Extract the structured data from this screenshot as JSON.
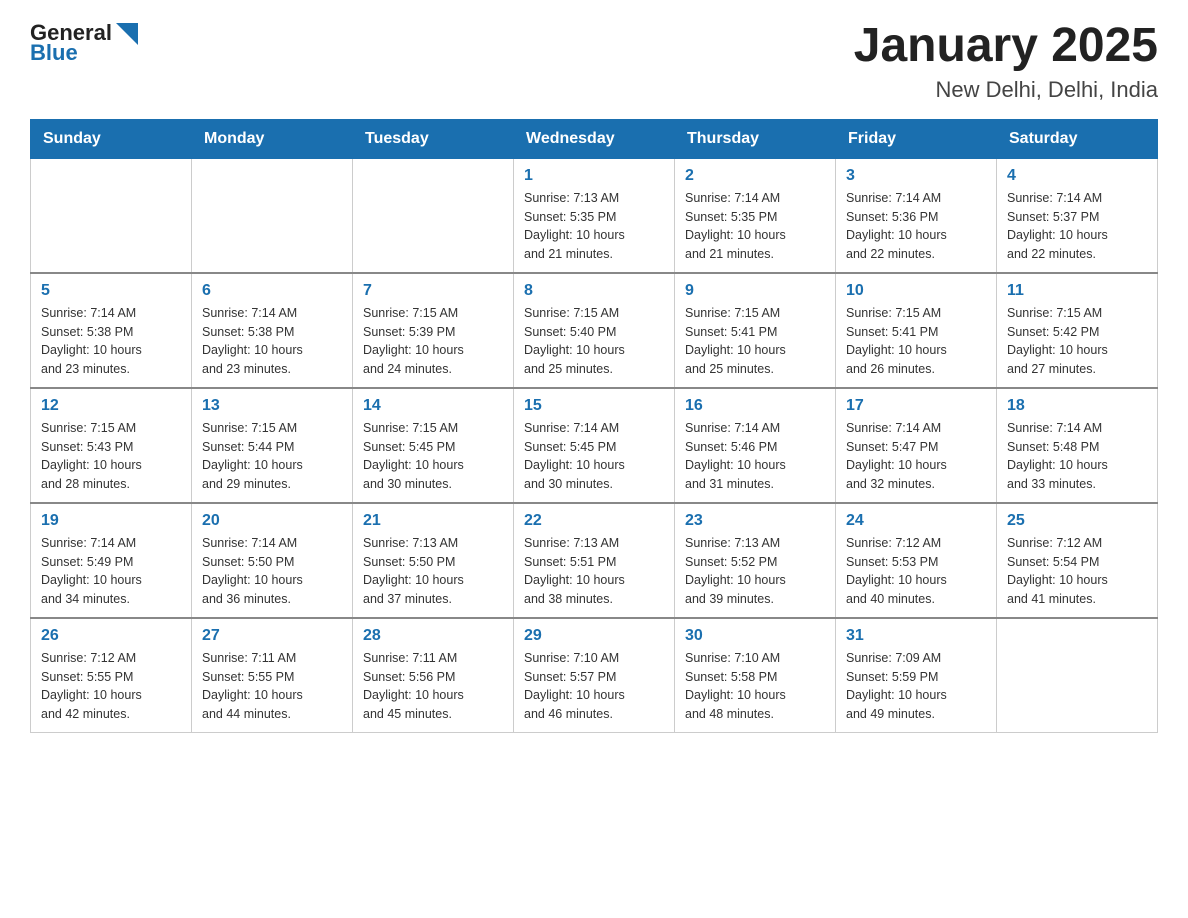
{
  "header": {
    "logo_general": "General",
    "logo_blue": "Blue",
    "title": "January 2025",
    "subtitle": "New Delhi, Delhi, India"
  },
  "days_of_week": [
    "Sunday",
    "Monday",
    "Tuesday",
    "Wednesday",
    "Thursday",
    "Friday",
    "Saturday"
  ],
  "weeks": [
    [
      {
        "day": "",
        "info": ""
      },
      {
        "day": "",
        "info": ""
      },
      {
        "day": "",
        "info": ""
      },
      {
        "day": "1",
        "info": "Sunrise: 7:13 AM\nSunset: 5:35 PM\nDaylight: 10 hours\nand 21 minutes."
      },
      {
        "day": "2",
        "info": "Sunrise: 7:14 AM\nSunset: 5:35 PM\nDaylight: 10 hours\nand 21 minutes."
      },
      {
        "day": "3",
        "info": "Sunrise: 7:14 AM\nSunset: 5:36 PM\nDaylight: 10 hours\nand 22 minutes."
      },
      {
        "day": "4",
        "info": "Sunrise: 7:14 AM\nSunset: 5:37 PM\nDaylight: 10 hours\nand 22 minutes."
      }
    ],
    [
      {
        "day": "5",
        "info": "Sunrise: 7:14 AM\nSunset: 5:38 PM\nDaylight: 10 hours\nand 23 minutes."
      },
      {
        "day": "6",
        "info": "Sunrise: 7:14 AM\nSunset: 5:38 PM\nDaylight: 10 hours\nand 23 minutes."
      },
      {
        "day": "7",
        "info": "Sunrise: 7:15 AM\nSunset: 5:39 PM\nDaylight: 10 hours\nand 24 minutes."
      },
      {
        "day": "8",
        "info": "Sunrise: 7:15 AM\nSunset: 5:40 PM\nDaylight: 10 hours\nand 25 minutes."
      },
      {
        "day": "9",
        "info": "Sunrise: 7:15 AM\nSunset: 5:41 PM\nDaylight: 10 hours\nand 25 minutes."
      },
      {
        "day": "10",
        "info": "Sunrise: 7:15 AM\nSunset: 5:41 PM\nDaylight: 10 hours\nand 26 minutes."
      },
      {
        "day": "11",
        "info": "Sunrise: 7:15 AM\nSunset: 5:42 PM\nDaylight: 10 hours\nand 27 minutes."
      }
    ],
    [
      {
        "day": "12",
        "info": "Sunrise: 7:15 AM\nSunset: 5:43 PM\nDaylight: 10 hours\nand 28 minutes."
      },
      {
        "day": "13",
        "info": "Sunrise: 7:15 AM\nSunset: 5:44 PM\nDaylight: 10 hours\nand 29 minutes."
      },
      {
        "day": "14",
        "info": "Sunrise: 7:15 AM\nSunset: 5:45 PM\nDaylight: 10 hours\nand 30 minutes."
      },
      {
        "day": "15",
        "info": "Sunrise: 7:14 AM\nSunset: 5:45 PM\nDaylight: 10 hours\nand 30 minutes."
      },
      {
        "day": "16",
        "info": "Sunrise: 7:14 AM\nSunset: 5:46 PM\nDaylight: 10 hours\nand 31 minutes."
      },
      {
        "day": "17",
        "info": "Sunrise: 7:14 AM\nSunset: 5:47 PM\nDaylight: 10 hours\nand 32 minutes."
      },
      {
        "day": "18",
        "info": "Sunrise: 7:14 AM\nSunset: 5:48 PM\nDaylight: 10 hours\nand 33 minutes."
      }
    ],
    [
      {
        "day": "19",
        "info": "Sunrise: 7:14 AM\nSunset: 5:49 PM\nDaylight: 10 hours\nand 34 minutes."
      },
      {
        "day": "20",
        "info": "Sunrise: 7:14 AM\nSunset: 5:50 PM\nDaylight: 10 hours\nand 36 minutes."
      },
      {
        "day": "21",
        "info": "Sunrise: 7:13 AM\nSunset: 5:50 PM\nDaylight: 10 hours\nand 37 minutes."
      },
      {
        "day": "22",
        "info": "Sunrise: 7:13 AM\nSunset: 5:51 PM\nDaylight: 10 hours\nand 38 minutes."
      },
      {
        "day": "23",
        "info": "Sunrise: 7:13 AM\nSunset: 5:52 PM\nDaylight: 10 hours\nand 39 minutes."
      },
      {
        "day": "24",
        "info": "Sunrise: 7:12 AM\nSunset: 5:53 PM\nDaylight: 10 hours\nand 40 minutes."
      },
      {
        "day": "25",
        "info": "Sunrise: 7:12 AM\nSunset: 5:54 PM\nDaylight: 10 hours\nand 41 minutes."
      }
    ],
    [
      {
        "day": "26",
        "info": "Sunrise: 7:12 AM\nSunset: 5:55 PM\nDaylight: 10 hours\nand 42 minutes."
      },
      {
        "day": "27",
        "info": "Sunrise: 7:11 AM\nSunset: 5:55 PM\nDaylight: 10 hours\nand 44 minutes."
      },
      {
        "day": "28",
        "info": "Sunrise: 7:11 AM\nSunset: 5:56 PM\nDaylight: 10 hours\nand 45 minutes."
      },
      {
        "day": "29",
        "info": "Sunrise: 7:10 AM\nSunset: 5:57 PM\nDaylight: 10 hours\nand 46 minutes."
      },
      {
        "day": "30",
        "info": "Sunrise: 7:10 AM\nSunset: 5:58 PM\nDaylight: 10 hours\nand 48 minutes."
      },
      {
        "day": "31",
        "info": "Sunrise: 7:09 AM\nSunset: 5:59 PM\nDaylight: 10 hours\nand 49 minutes."
      },
      {
        "day": "",
        "info": ""
      }
    ]
  ]
}
